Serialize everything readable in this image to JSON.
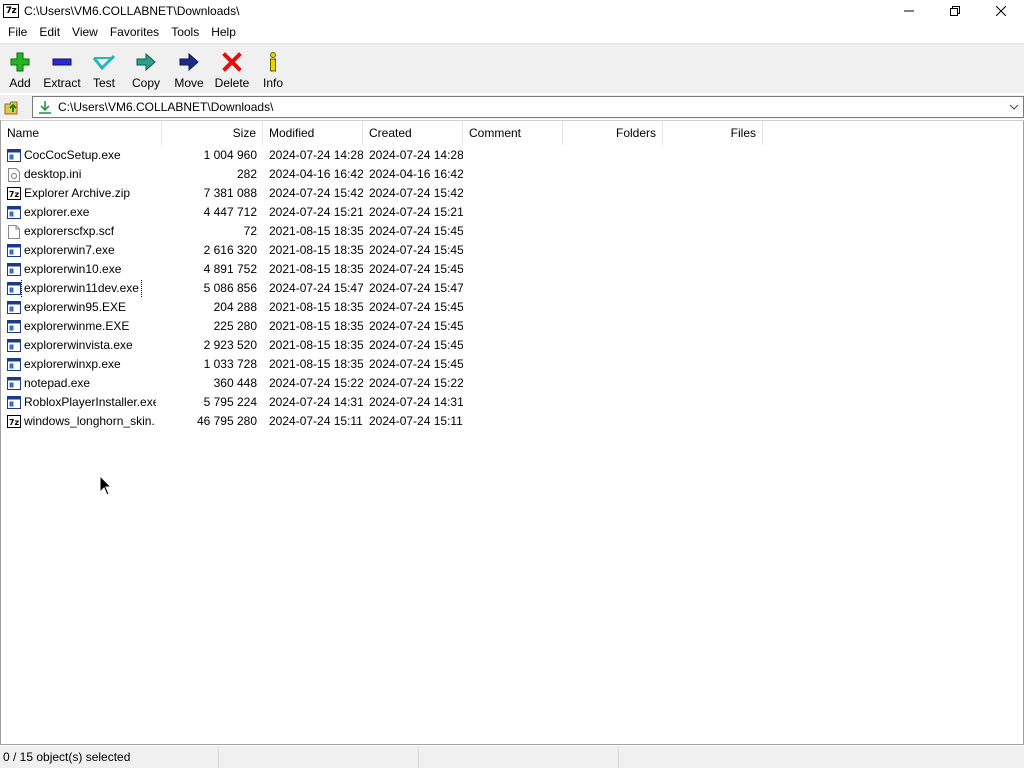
{
  "window": {
    "title": "C:\\Users\\VM6.COLLABNET\\Downloads\\",
    "app_icon_text": "7z"
  },
  "menu": [
    "File",
    "Edit",
    "View",
    "Favorites",
    "Tools",
    "Help"
  ],
  "toolbar": [
    {
      "label": "Add",
      "icon": "add-icon"
    },
    {
      "label": "Extract",
      "icon": "extract-icon"
    },
    {
      "label": "Test",
      "icon": "test-icon"
    },
    {
      "label": "Copy",
      "icon": "copy-icon"
    },
    {
      "label": "Move",
      "icon": "move-icon"
    },
    {
      "label": "Delete",
      "icon": "delete-icon"
    },
    {
      "label": "Info",
      "icon": "info-icon"
    }
  ],
  "address": {
    "path": "C:\\Users\\VM6.COLLABNET\\Downloads\\"
  },
  "columns": [
    "Name",
    "Size",
    "Modified",
    "Created",
    "Comment",
    "Folders",
    "Files"
  ],
  "files": [
    {
      "name": "CocCocSetup.exe",
      "size": "1 004 960",
      "modified": "2024-07-24 14:28",
      "created": "2024-07-24 14:28",
      "icon": "exe"
    },
    {
      "name": "desktop.ini",
      "size": "282",
      "modified": "2024-04-16 16:42",
      "created": "2024-04-16 16:42",
      "icon": "ini"
    },
    {
      "name": "Explorer Archive.zip",
      "size": "7 381 088",
      "modified": "2024-07-24 15:42",
      "created": "2024-07-24 15:42",
      "icon": "archive"
    },
    {
      "name": "explorer.exe",
      "size": "4 447 712",
      "modified": "2024-07-24 15:21",
      "created": "2024-07-24 15:21",
      "icon": "exe"
    },
    {
      "name": "explorerscfxp.scf",
      "size": "72",
      "modified": "2021-08-15 18:35",
      "created": "2024-07-24 15:45",
      "icon": "file"
    },
    {
      "name": "explorerwin7.exe",
      "size": "2 616 320",
      "modified": "2021-08-15 18:35",
      "created": "2024-07-24 15:45",
      "icon": "exe"
    },
    {
      "name": "explorerwin10.exe",
      "size": "4 891 752",
      "modified": "2021-08-15 18:35",
      "created": "2024-07-24 15:45",
      "icon": "exe"
    },
    {
      "name": "explorerwin11dev.exe",
      "size": "5 086 856",
      "modified": "2024-07-24 15:47",
      "created": "2024-07-24 15:47",
      "icon": "exe",
      "focused": true
    },
    {
      "name": "explorerwin95.EXE",
      "size": "204 288",
      "modified": "2021-08-15 18:35",
      "created": "2024-07-24 15:45",
      "icon": "exe"
    },
    {
      "name": "explorerwinme.EXE",
      "size": "225 280",
      "modified": "2021-08-15 18:35",
      "created": "2024-07-24 15:45",
      "icon": "exe"
    },
    {
      "name": "explorerwinvista.exe",
      "size": "2 923 520",
      "modified": "2021-08-15 18:35",
      "created": "2024-07-24 15:45",
      "icon": "exe"
    },
    {
      "name": "explorerwinxp.exe",
      "size": "1 033 728",
      "modified": "2021-08-15 18:35",
      "created": "2024-07-24 15:45",
      "icon": "exe"
    },
    {
      "name": "notepad.exe",
      "size": "360 448",
      "modified": "2024-07-24 15:22",
      "created": "2024-07-24 15:22",
      "icon": "exe"
    },
    {
      "name": "RobloxPlayerInstaller.exe",
      "size": "5 795 224",
      "modified": "2024-07-24 14:31",
      "created": "2024-07-24 14:31",
      "icon": "exe"
    },
    {
      "name": "windows_longhorn_skin...",
      "size": "46 795 280",
      "modified": "2024-07-24 15:11",
      "created": "2024-07-24 15:11",
      "icon": "archive"
    }
  ],
  "status": {
    "selection": "0 / 15 object(s) selected",
    "segment2": "",
    "segment3": ""
  }
}
